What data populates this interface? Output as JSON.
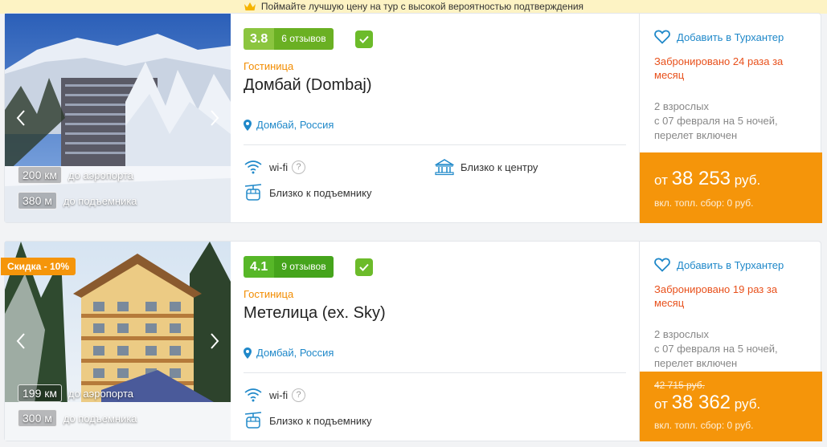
{
  "banner": {
    "text": "Поймайте лучшую цену на тур с высокой вероятностью подтверждения",
    "icon": "crown-icon"
  },
  "hotels": [
    {
      "rating": "3.8",
      "reviews": "6 отзывов",
      "type": "Гостиница",
      "name": "Домбай (Dombaj)",
      "location": "Домбай, Россия",
      "distances": [
        {
          "value": "200 км",
          "label": "до аэропорта"
        },
        {
          "value": "380 м",
          "label": "до подъемника"
        }
      ],
      "amenities": [
        {
          "label": "wi-fi",
          "icon": "wifi-icon",
          "help": "?"
        },
        {
          "label": "Близко к центру",
          "icon": "city-center-icon"
        },
        {
          "label": "Близко к подъемнику",
          "icon": "ski-lift-icon"
        }
      ],
      "favorite": "Добавить в Турхантер",
      "booked": "Забронировано 24 раза за месяц",
      "tour_lines": [
        "2 взрослых",
        "с 07 февраля на 5 ночей,",
        "перелет включен"
      ],
      "price_prefix": "от",
      "price": "38 253",
      "currency": "руб.",
      "fee": "вкл. топл. сбор: 0 руб."
    },
    {
      "discount": "Скидка - 10%",
      "rating": "4.1",
      "reviews": "9 отзывов",
      "type": "Гостиница",
      "name": "Метелица (ex. Sky)",
      "location": "Домбай, Россия",
      "distances": [
        {
          "value": "199 км",
          "label": "до аэропорта"
        },
        {
          "value": "300 м",
          "label": "до подъемника"
        }
      ],
      "amenities": [
        {
          "label": "wi-fi",
          "icon": "wifi-icon",
          "help": "?"
        },
        {
          "label": "Близко к подъемнику",
          "icon": "ski-lift-icon"
        }
      ],
      "favorite": "Добавить в Турхантер",
      "booked": "Забронировано 19 раз за месяц",
      "tour_lines": [
        "2 взрослых",
        "с 07 февраля на 5 ночей,",
        "перелет включен"
      ],
      "old_price": "42 715 руб.",
      "price_prefix": "от",
      "price": "38 362",
      "currency": "руб.",
      "fee": "вкл. топл. сбор: 0 руб."
    }
  ],
  "colors": {
    "accent": "#f5950a",
    "link": "#1f88c9",
    "booked": "#e8501b",
    "type": "#f28c00",
    "rating": "#6cbb2a"
  }
}
